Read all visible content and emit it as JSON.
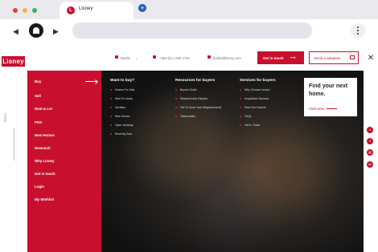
{
  "browser": {
    "tab_title": "Lisney",
    "tab_favicon_letter": "L",
    "new_tab_symbol": "+",
    "back_symbol": "◀",
    "forward_symbol": "▶",
    "traffic_colors": [
      "#e0413b",
      "#f3b23a",
      "#38b84c"
    ]
  },
  "header": {
    "logo": "Lisney",
    "location": "Dublin",
    "phone": "+353 (0) 1 638 1700",
    "email": "dublin@lisney.com",
    "get_in_touch": "Get in touch",
    "book_valuation": "Book a valuation",
    "close_symbol": "✕"
  },
  "menu_label": "Menu",
  "primary_nav": [
    {
      "label": "Buy"
    },
    {
      "label": "Sell"
    },
    {
      "label": "Rent & Let"
    },
    {
      "label": "PRS"
    },
    {
      "label": "New Homes"
    },
    {
      "label": "Research"
    },
    {
      "label": "Why Lisney"
    },
    {
      "label": "Get in touch"
    },
    {
      "label": "Login"
    },
    {
      "label": "My Wishlist"
    }
  ],
  "columns": [
    {
      "heading": "Want to buy?",
      "items": [
        "Homes For Sale",
        "New To Lisney",
        "Auctions",
        "New Homes",
        "Open Viewings",
        "Recently Sold"
      ]
    },
    {
      "heading": "Resources for buyers",
      "items": [
        "Buyers Guide",
        "Research And Reports",
        "Get To Know Your Neighbourhood",
        "Testimonials"
      ]
    },
    {
      "heading": "Services for buyers",
      "items": [
        "Why Choose Lisney?",
        "Acquisition Services",
        "Meet Our Experts",
        "FAQs",
        "Get In Touch"
      ]
    }
  ],
  "card": {
    "title": "Find your next home.",
    "link": "Click Here"
  },
  "social": [
    {
      "icon": "twitter-icon",
      "glyph": "t"
    },
    {
      "icon": "facebook-icon",
      "glyph": "f"
    },
    {
      "icon": "instagram-icon",
      "glyph": "◎"
    },
    {
      "icon": "linkedin-icon",
      "glyph": "in"
    }
  ],
  "colors": {
    "brand_red": "#c8102e",
    "dark_bg": "#151515"
  }
}
